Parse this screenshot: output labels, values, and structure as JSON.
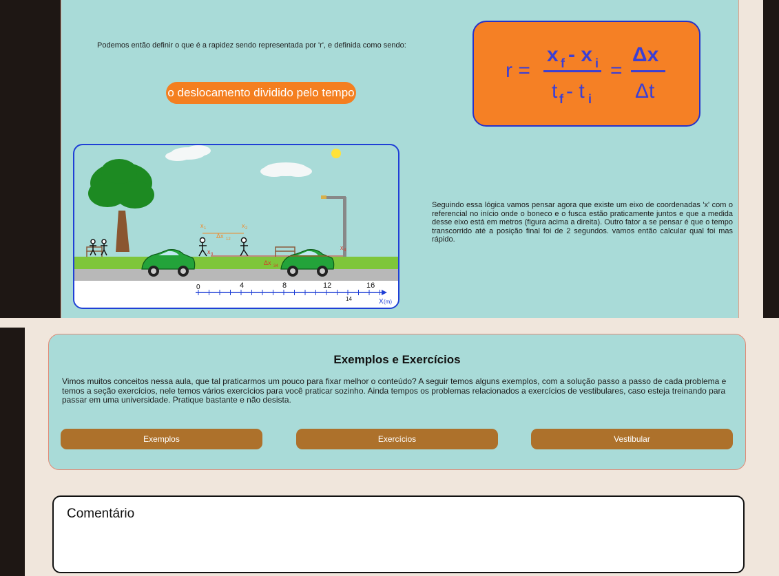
{
  "lesson": {
    "intro_text": "Podemos então definir o que é a rapidez sendo representada por 'r', e definida como sendo:",
    "definition_pill": "o deslocamento dividido pelo tempo",
    "formula": {
      "lhs": "r =",
      "num": "x",
      "num_f": "f",
      "num_minus": "- x",
      "num_i": "i",
      "den": "t",
      "den_f": "f",
      "den_minus": "- t",
      "den_i": "i",
      "eq2": "=",
      "delta_num": "Δx",
      "delta_den": "Δt"
    },
    "scene": {
      "labels": {
        "x1": "x",
        "x1_sub": "1",
        "x2": "x",
        "x2_sub": "2",
        "x3": "x",
        "x3_sub": "3",
        "x4": "x",
        "x4_sub": "4",
        "dx12": "Δx",
        "dx12_sub": "12",
        "dx34": "Δx",
        "dx34_sub": "34"
      },
      "axis": {
        "ticks": [
          "0",
          "4",
          "8",
          "12",
          "16"
        ],
        "extra_tick": "14",
        "unit_label": "X",
        "unit_paren": "(m)"
      }
    },
    "description": "Seguindo essa lógica vamos pensar agora que existe um eixo de coordenadas 'x' com o referencial no início onde o boneco e o fusca estão praticamente juntos e que a medida desse eixo está em metros (figura acima a direita). Outro fator a se pensar é que o tempo transcorrido até a posição final foi de 2 segundos. vamos então calcular qual foi mas rápido."
  },
  "examples": {
    "title": "Exemplos e Exercícios",
    "text": "Vimos muitos conceitos nessa aula, que tal praticarmos um pouco para fixar melhor o conteúdo? A seguir temos alguns exemplos, com a solução passo a passo de cada problema e temos a seção exercícios, nele temos vários exercícios para você praticar sozinho. Ainda tempos os problemas relacionados a exercícios de vestibulares, caso esteja treinando para passar em uma universidade. Pratique bastante e não desista.",
    "buttons": [
      "Exemplos",
      "Exercícios",
      "Vestibular"
    ]
  },
  "comment": {
    "label": "Comentário"
  },
  "colors": {
    "panel": "#a9dbd8",
    "orange": "#f58025",
    "formula_text": "#3a3fd6",
    "button_brown": "#ad712b",
    "scene_border": "#1f3fd6"
  }
}
